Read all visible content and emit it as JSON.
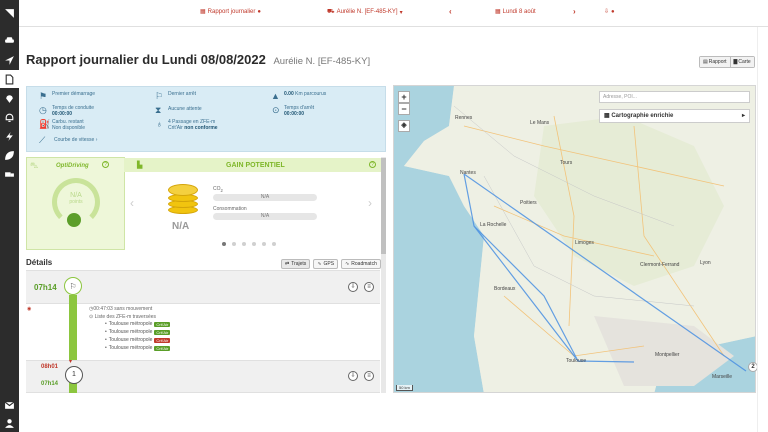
{
  "sidebar": {
    "icons": [
      "logo-icon",
      "car-icon",
      "location-arrow-icon",
      "document-icon",
      "map-pin-icon",
      "bell-icon",
      "lightning-icon",
      "leaf-icon",
      "truck-icon",
      "mail-icon",
      "user-icon"
    ]
  },
  "topbar": {
    "report": "Rapport journalier",
    "driver": "Aurélie N. [EF-485-KY]",
    "date": "Lundi 8 août",
    "prev": "‹",
    "next": "›"
  },
  "header": {
    "title": "Rapport journalier du Lundi 08/08/2022",
    "subtitle": "Aurélie N. [EF-485-KY]"
  },
  "view_toggle": {
    "report": "Rapport",
    "map": "Carte"
  },
  "summary": {
    "first_start": "Premier démarrage",
    "last_stop": "Dernier arrêt",
    "distance_value": "0.00",
    "distance_unit": "Km parcourus",
    "drive_time_label": "Temps de conduite",
    "drive_time_value": "00:00:00",
    "no_wait": "Aucune attente",
    "stop_time_label": "Temps d'arrêt",
    "stop_time_value": "00:00:00",
    "fuel_label": "Carbu. restant",
    "fuel_value": "Non disponible",
    "zfe_label": "4 Passage en ZFE-m",
    "zfe_sub": "Crit'Air",
    "zfe_status": "non conforme",
    "speed_curve": "Courbe de vitesse"
  },
  "optidriving": {
    "title": "OptiDriving",
    "score": "N/A",
    "score_unit": "points"
  },
  "gain": {
    "title": "GAIN POTENTIEL",
    "value": "N/A",
    "co2_label": "CO",
    "co2_sub": "2",
    "co2_value": "N/A",
    "conso_label": "Consommation",
    "conso_value": "N/A"
  },
  "details": {
    "label": "Détails",
    "filters": [
      "Trajets",
      "GPS",
      "Roadmatch"
    ]
  },
  "segments": {
    "start_time": "07h14",
    "event_1": "00:47:03 sans mouvement",
    "event_2": "Liste des ZFE-m traversées",
    "zfe": [
      {
        "name": "Toulouse métropole",
        "status": "Crit'Air",
        "color": "#5a9e28"
      },
      {
        "name": "Toulouse métropole",
        "status": "Crit'Air",
        "color": "#5a9e28"
      },
      {
        "name": "Toulouse métropole",
        "status": "Crit'Air",
        "color": "#c0392b"
      },
      {
        "name": "Toulouse métropole",
        "status": "Crit'Air",
        "color": "#5a9e28"
      }
    ],
    "stop_time_red": "08h01",
    "stop_time_green": "07h14",
    "stop_number": "1"
  },
  "map": {
    "zoom_in": "+",
    "zoom_out": "−",
    "search_placeholder": "Adresse, POI...",
    "panel": "Cartographie enrichie",
    "scale": "50 km",
    "cities": [
      "Rennes",
      "Nantes",
      "Poitiers",
      "Bordeaux",
      "Toulouse",
      "Montpellier",
      "Marseille",
      "Lyon",
      "Limoges",
      "Clermont-Ferrand",
      "Tours",
      "Le Mans",
      "La Rochelle"
    ]
  },
  "colors": {
    "accent": "#c0392b",
    "green": "#8cc63f",
    "blue": "#d9ecf5"
  }
}
